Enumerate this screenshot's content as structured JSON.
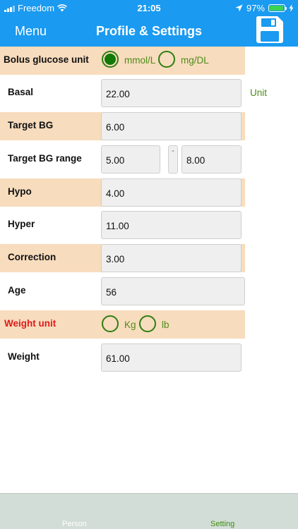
{
  "status_bar": {
    "carrier": "Freedom",
    "time": "21:05",
    "battery": "97%",
    "battery_level": 0.97
  },
  "nav": {
    "menu_label": "Menu",
    "title": "Profile & Settings",
    "save_icon": "floppy-disk-icon"
  },
  "bolus_unit": {
    "label": "Bolus glucose unit",
    "options": [
      "mmol/L",
      "mg/DL"
    ],
    "selected": "mmol/L"
  },
  "basal": {
    "label": "Basal",
    "value": "22.00",
    "unit": "Unit"
  },
  "target_bg": {
    "label": "Target BG",
    "value": "6.00"
  },
  "target_range": {
    "label": "Target BG range",
    "low": "5.00",
    "separator": "-",
    "high": "8.00"
  },
  "hypo": {
    "label": "Hypo",
    "value": "4.00"
  },
  "hyper": {
    "label": "Hyper",
    "value": "11.00"
  },
  "correction": {
    "label": "Correction",
    "value": "3.00"
  },
  "age": {
    "label": "Age",
    "value": "56"
  },
  "weight_unit": {
    "label": "Weight unit",
    "options": [
      "Kg",
      "lb"
    ],
    "selected": ""
  },
  "weight": {
    "label": "Weight",
    "value": "61.00"
  },
  "tabs": [
    {
      "label": "Person",
      "active": false
    },
    {
      "label": "Setting",
      "active": true
    }
  ],
  "colors": {
    "header": "#1a9af0",
    "shaded_row": "#f7dcbd",
    "accent_green": "#4e8b1a",
    "warning_red": "#e01a1a",
    "tab_bar": "#d2ddd7"
  }
}
